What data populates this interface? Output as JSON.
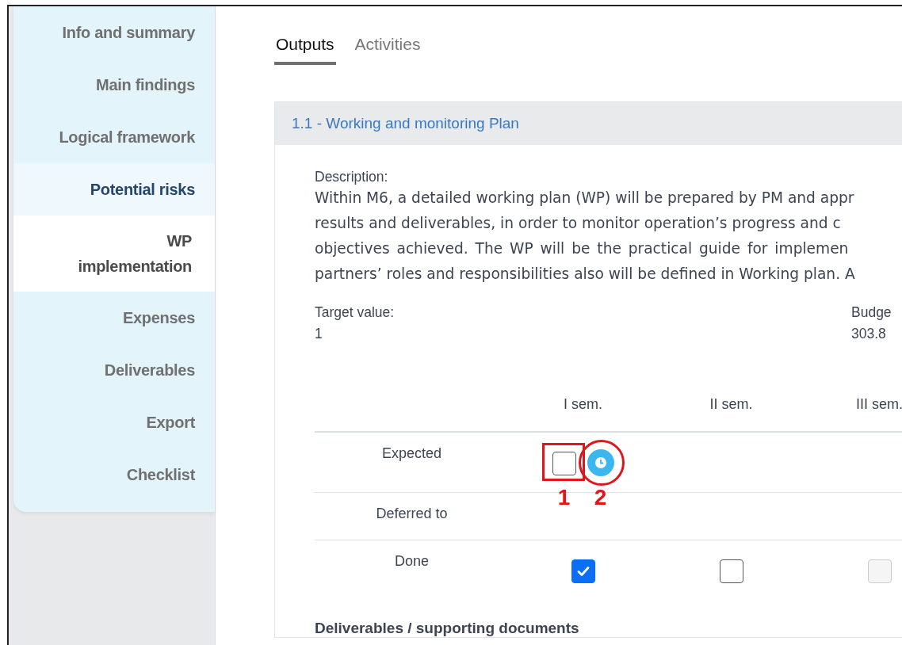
{
  "sidebar": {
    "items": [
      {
        "label": "Info and summary",
        "selected": false,
        "hovered": false
      },
      {
        "label": "Main findings",
        "selected": false,
        "hovered": false
      },
      {
        "label": "Logical framework",
        "selected": false,
        "hovered": false
      },
      {
        "label": "Potential risks",
        "selected": false,
        "hovered": true
      },
      {
        "label": "WP implementation",
        "selected": true,
        "hovered": false
      },
      {
        "label": "Expenses",
        "selected": false,
        "hovered": false
      },
      {
        "label": "Deliverables",
        "selected": false,
        "hovered": false
      },
      {
        "label": "Export",
        "selected": false,
        "hovered": false
      },
      {
        "label": "Checklist",
        "selected": false,
        "hovered": false
      }
    ]
  },
  "tabs": [
    {
      "label": "Outputs",
      "selected": true
    },
    {
      "label": "Activities",
      "selected": false
    }
  ],
  "output": {
    "title": "1.1 - Working and monitoring Plan",
    "description_label": "Description:",
    "description_lines": [
      "Within M6, a detailed working plan (WP) will be prepared by PM and appr",
      "results and deliverables, in order to monitor operation’s progress and c",
      "objectives achieved. The WP will be the practical guide for implemen",
      "partners’ roles and responsibilities also will be defined in Working plan. A"
    ],
    "fields": [
      {
        "label": "Target value:",
        "value": "1"
      },
      {
        "label": "Budge",
        "value": "303.8"
      }
    ],
    "table": {
      "columns": [
        "I sem.",
        "II sem.",
        "III sem."
      ],
      "rows": [
        {
          "label": "Expected",
          "cells": [
            {
              "kind": "checkbox",
              "checked": false,
              "disabled": false,
              "clock_button": true,
              "callouts": [
                "1",
                "2"
              ]
            },
            {
              "kind": "empty"
            },
            {
              "kind": "empty"
            }
          ]
        },
        {
          "label": "Deferred to",
          "cells": [
            {
              "kind": "empty"
            },
            {
              "kind": "empty"
            },
            {
              "kind": "empty"
            }
          ]
        },
        {
          "label": "Done",
          "cells": [
            {
              "kind": "checkbox",
              "checked": true,
              "disabled": false
            },
            {
              "kind": "checkbox",
              "checked": false,
              "disabled": false
            },
            {
              "kind": "checkbox",
              "checked": false,
              "disabled": true
            }
          ]
        }
      ]
    },
    "section_heading": "Deliverables / supporting documents"
  }
}
